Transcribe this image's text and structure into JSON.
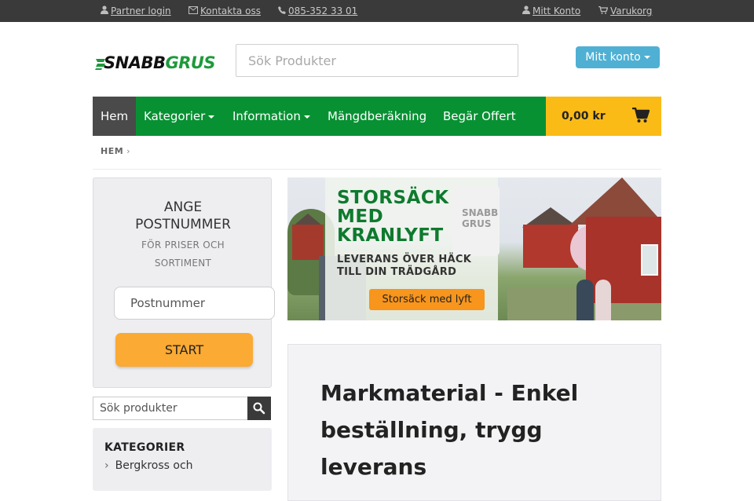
{
  "topbar": {
    "partner_login": "Partner login",
    "contact": "Kontakta oss",
    "phone": "085-352 33 01",
    "my_account": "Mitt Konto",
    "cart": "Varukorg"
  },
  "header": {
    "logo_text": "SNABBGRUS",
    "search_placeholder": "Sök Produkter",
    "account_button": "Mitt konto"
  },
  "nav": {
    "items": [
      "Hem",
      "Kategorier",
      "Information",
      "Mängdberäkning",
      "Begär Offert"
    ],
    "cart_amount": "0,00 kr"
  },
  "breadcrumb": {
    "home": "HEM",
    "separator": "›"
  },
  "postcode_box": {
    "title": "ANGE POSTNUMMER",
    "subtitle": "FÖR PRISER OCH SORTIMENT",
    "input_placeholder": "Postnummer",
    "start_button": "START"
  },
  "sidebar": {
    "search_placeholder": "Sök produkter",
    "categories_title": "KATEGORIER",
    "categories": [
      "Bergkross och"
    ]
  },
  "banner": {
    "headline": "STORSÄCK MED KRANLYFT",
    "subline": "LEVERANS ÖVER HÄCK TILL DIN TRÄDGÅRD",
    "button": "Storsäck med lyft",
    "bag_text": "SNABB GRUS"
  },
  "content": {
    "title": "Markmaterial - Enkel beställning, trygg leverans"
  },
  "colors": {
    "nav_green": "#089133",
    "cart_yellow": "#fbbb16",
    "account_blue": "#4fb0d4",
    "start_orange": "#fbaa33",
    "topbar_dark": "#3a3a3a"
  },
  "icons": {
    "partner_login": "user-icon",
    "contact": "envelope-icon",
    "phone": "phone-icon",
    "my_account": "user-icon",
    "cart": "cart-icon",
    "search": "search-icon"
  }
}
